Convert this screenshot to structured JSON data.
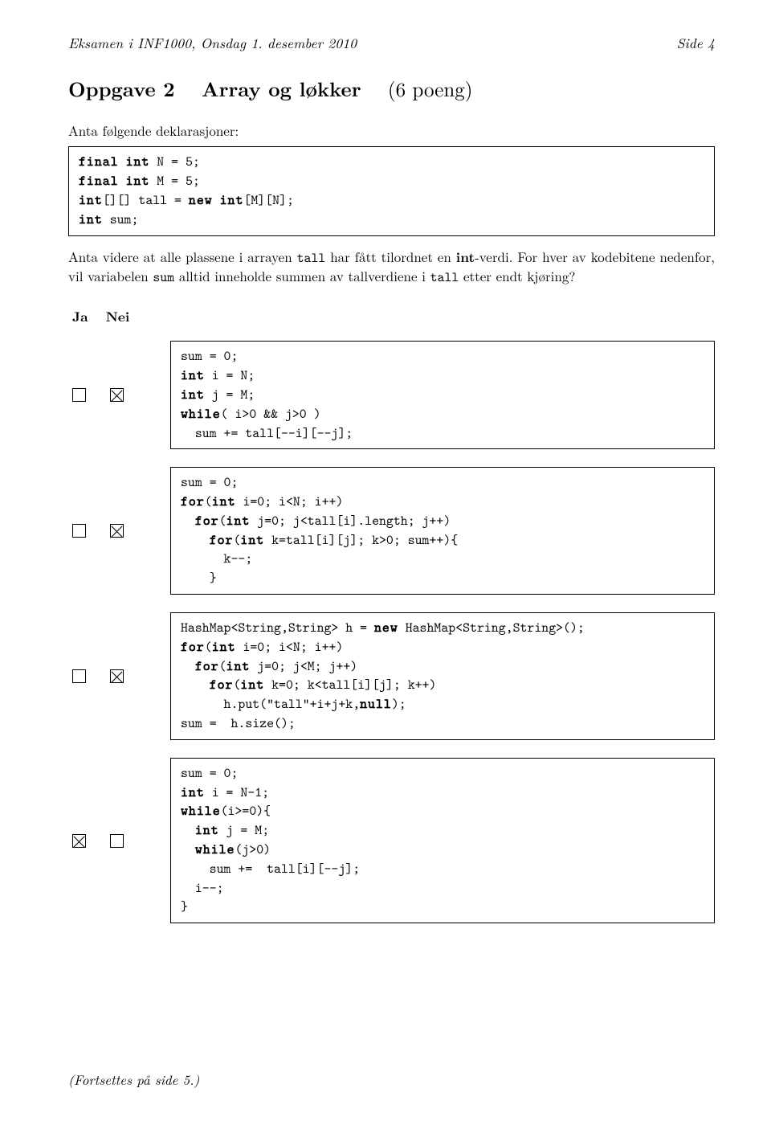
{
  "header": {
    "left": "Eksamen i INF1000, Onsdag 1. desember 2010",
    "right": "Side 4"
  },
  "task": {
    "label": "Oppgave 2",
    "title": "Array og løkker",
    "points": "(6 poeng)"
  },
  "intro": "Anta følgende deklarasjoner:",
  "decl_code": "final int N = 5;\nfinal int M = 5;\nint[][] tall = new int[M][N];\nint sum;",
  "para_part1": "Anta videre at alle plassene i arrayen ",
  "para_tt1": "tall",
  "para_part2": " har fått tilordnet en ",
  "para_bold": "int",
  "para_part3": "-verdi. For hver av kodebitene nedenfor, vil variabelen ",
  "para_tt2": "sum",
  "para_part4": " alltid inneholde summen av tallverdiene i ",
  "para_tt3": "tall",
  "para_part5": " etter endt kjøring?",
  "cols": {
    "ja": "Ja",
    "nei": "Nei"
  },
  "rows": [
    {
      "ja": false,
      "nei": true,
      "code": "sum = 0;\nint i = N;\nint j = M;\nwhile( i>0 && j>0 )\n  sum += tall[--i][--j];"
    },
    {
      "ja": false,
      "nei": true,
      "code": "sum = 0;\nfor(int i=0; i<N; i++)\n  for(int j=0; j<tall[i].length; j++)\n    for(int k=tall[i][j]; k>0; sum++){\n      k--;\n    }"
    },
    {
      "ja": false,
      "nei": true,
      "code": "HashMap<String,String> h = new HashMap<String,String>();\nfor(int i=0; i<N; i++)\n  for(int j=0; j<M; j++)\n    for(int k=0; k<tall[i][j]; k++)\n      h.put(\"tall\"+i+j+k,null);\nsum =  h.size();"
    },
    {
      "ja": true,
      "nei": false,
      "code": "sum = 0;\nint i = N-1;\nwhile(i>=0){\n  int j = M;\n  while(j>0)\n    sum +=  tall[i][--j];\n  i--;\n}"
    }
  ],
  "footer": "(Fortsettes på side 5.)"
}
